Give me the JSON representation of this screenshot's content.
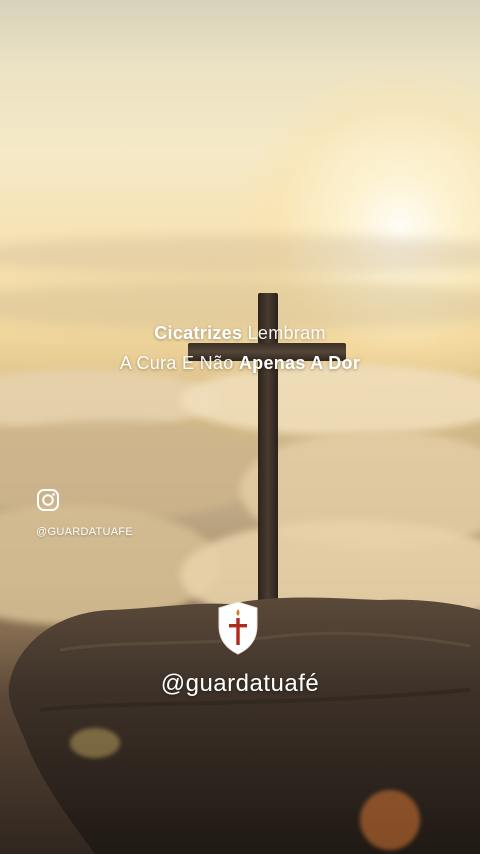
{
  "quote": {
    "line1_strong": "Cicatrizes",
    "line1_light": "Lembram",
    "line2_light": "A Cura E Não",
    "line2_strong": "Apenas A Dor"
  },
  "instagram": {
    "icon": "instagram-icon",
    "handle": "@GUARDATUAFE"
  },
  "brand": {
    "logo_icon": "shield-cross-icon",
    "handle": "@guardatuafé"
  },
  "colors": {
    "shield_red": "#b12a1f",
    "text": "#ffffff"
  }
}
